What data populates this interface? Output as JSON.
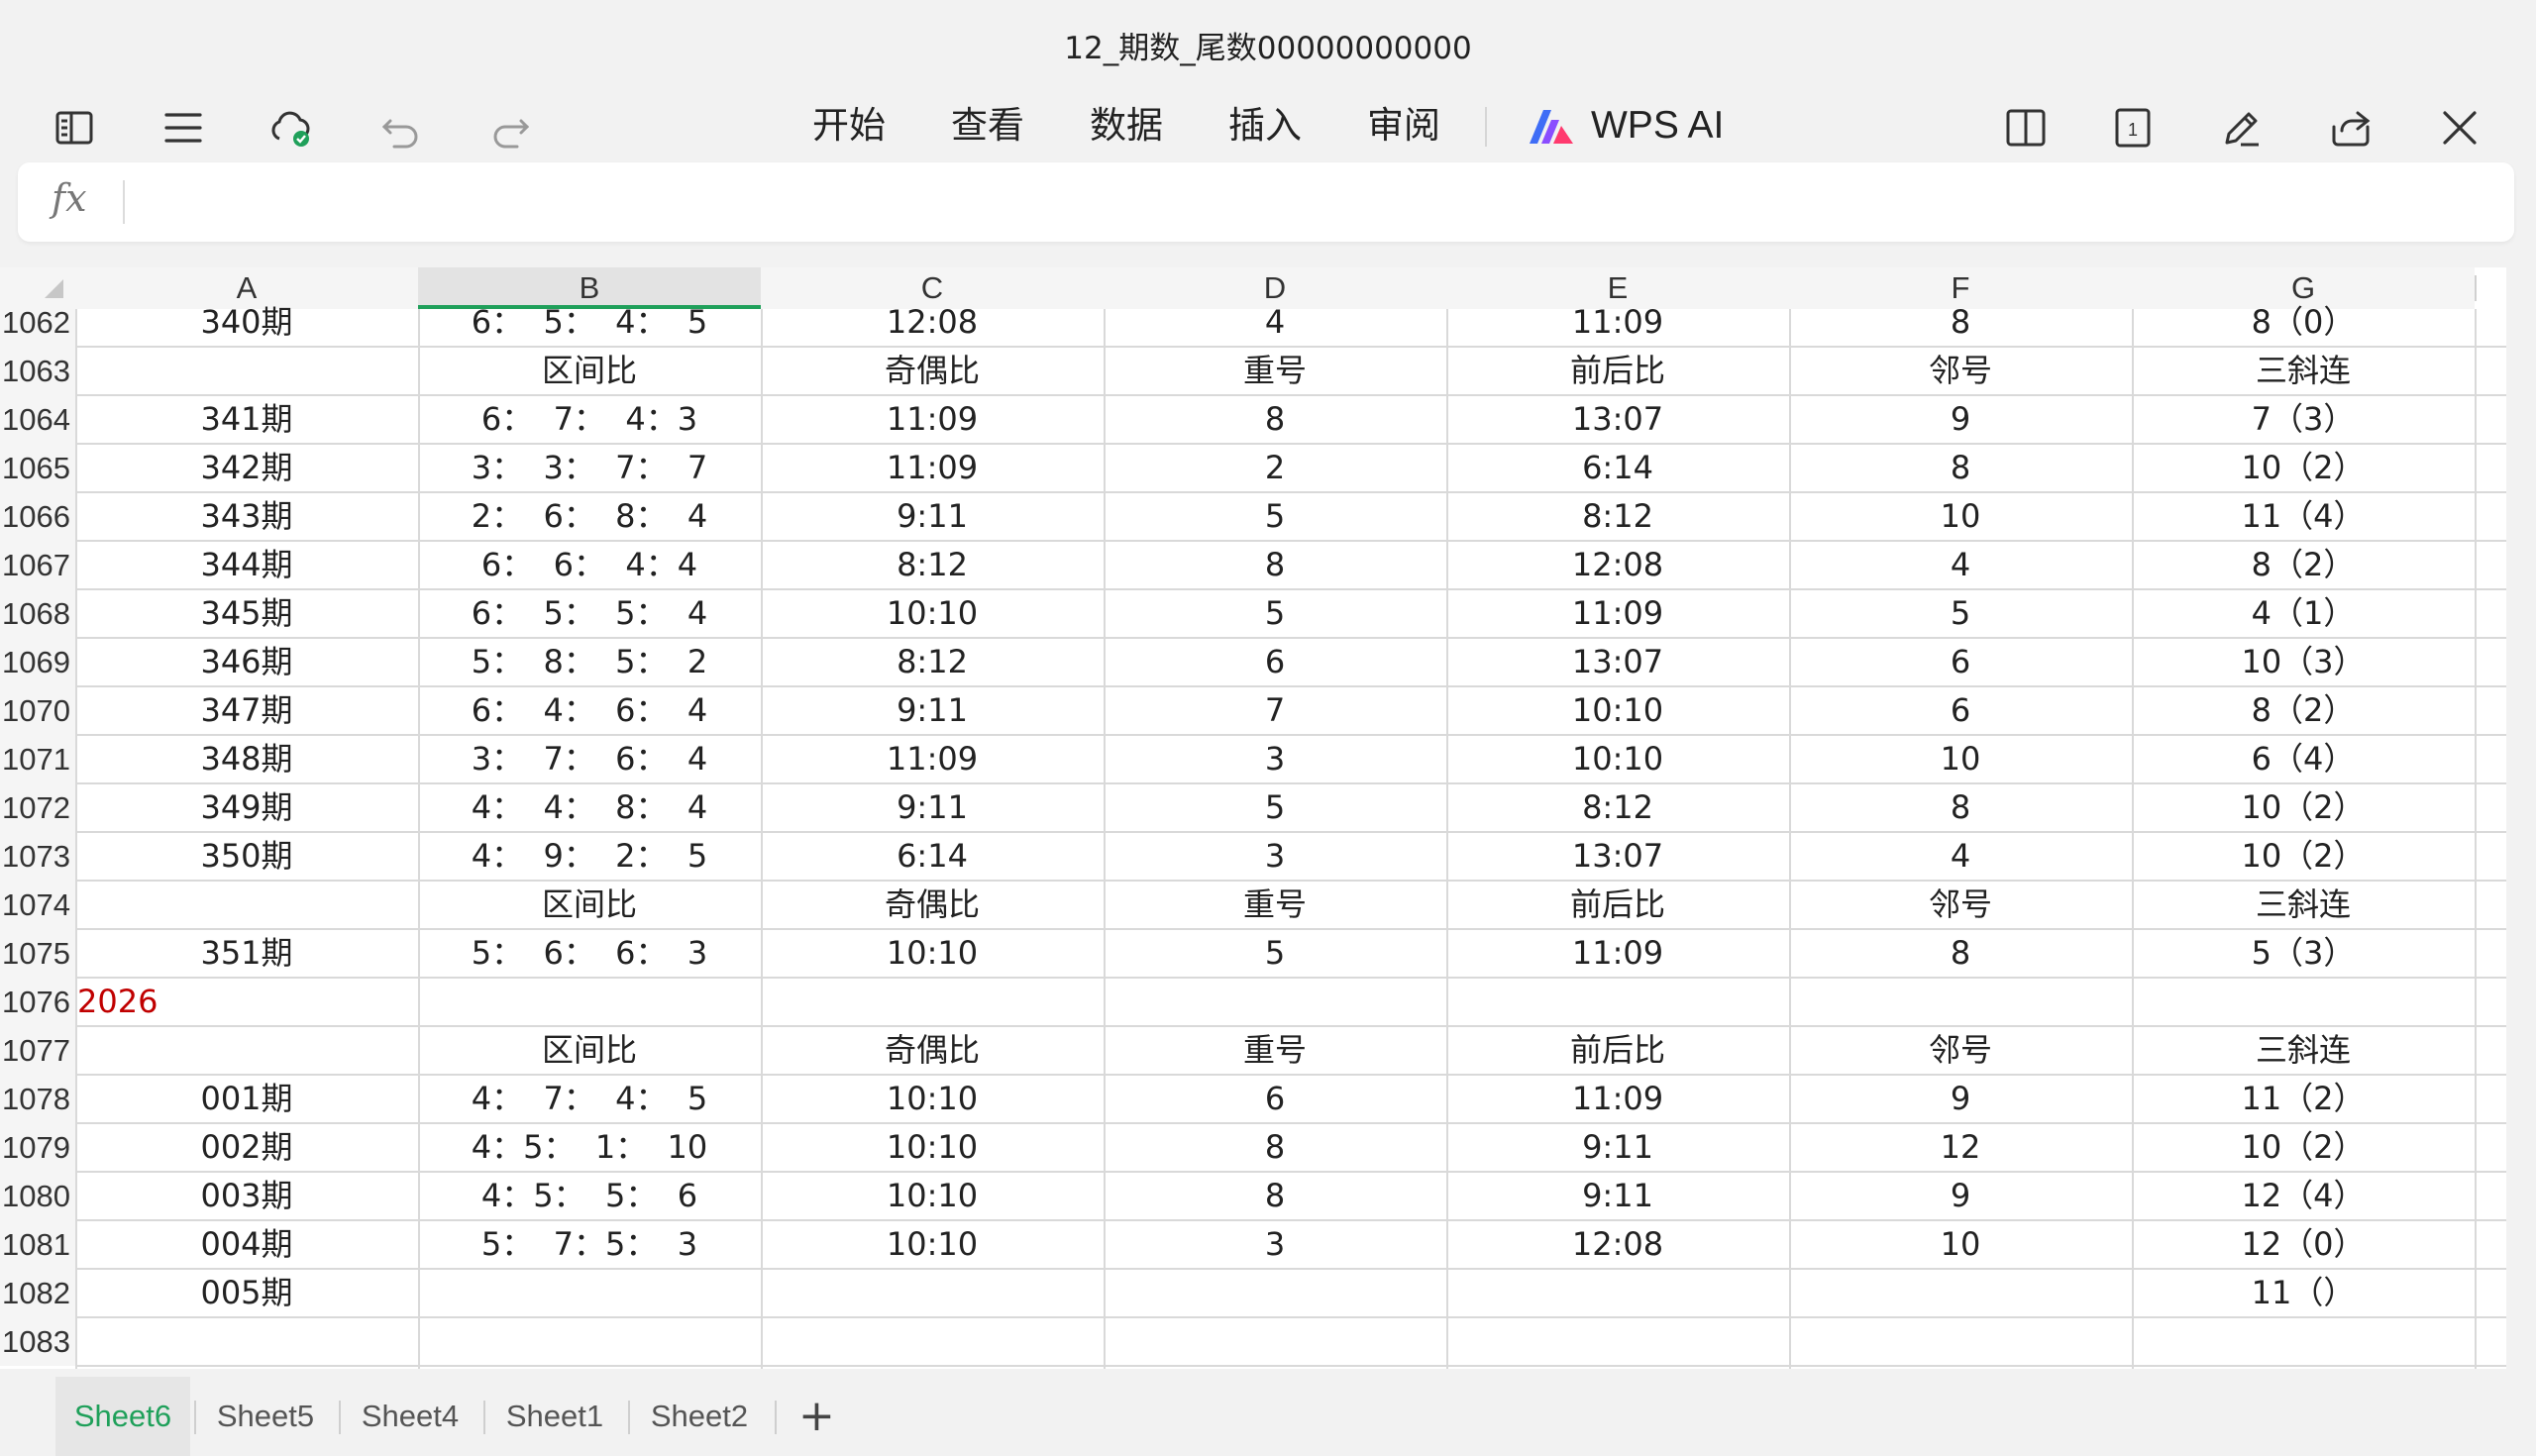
{
  "window": {
    "title": "12_期数_尾数00000000000"
  },
  "toolbar": {
    "left_icons": [
      "sidebar-toggle-icon",
      "menu-icon",
      "cloud-synced-icon",
      "undo-icon",
      "redo-icon"
    ],
    "menus": [
      "开始",
      "查看",
      "数据",
      "插入",
      "审阅"
    ],
    "ai_label": "WPS AI",
    "right_icons": [
      "split-view-icon",
      "page-count-icon",
      "pen-edit-icon",
      "share-icon",
      "close-icon"
    ],
    "page_count": "1"
  },
  "formula_bar": {
    "fx_label": "fx",
    "value": ""
  },
  "columns": [
    "A",
    "B",
    "C",
    "D",
    "E",
    "F",
    "G"
  ],
  "selected_column": "B",
  "rows": [
    {
      "num": "1062",
      "cells": [
        "340期",
        "6：  5：  4：  5",
        "12:08",
        "4",
        "11:09",
        "8",
        "8（0）"
      ]
    },
    {
      "num": "1063",
      "cells": [
        "",
        "区间比",
        "奇偶比",
        "重号",
        "前后比",
        "邻号",
        "三斜连"
      ]
    },
    {
      "num": "1064",
      "cells": [
        "341期",
        "6：  7：  4：3",
        "11:09",
        "8",
        "13:07",
        "9",
        "7（3）"
      ]
    },
    {
      "num": "1065",
      "cells": [
        "342期",
        "3：  3：  7：  7",
        "11:09",
        "2",
        "6:14",
        "8",
        "10（2）"
      ]
    },
    {
      "num": "1066",
      "cells": [
        "343期",
        "2：  6：  8：  4",
        "9:11",
        "5",
        "8:12",
        "10",
        "11（4）"
      ]
    },
    {
      "num": "1067",
      "cells": [
        "344期",
        "6：  6：  4：4",
        "8:12",
        "8",
        "12:08",
        "4",
        "8（2）"
      ]
    },
    {
      "num": "1068",
      "cells": [
        "345期",
        "6：  5：  5：  4",
        "10:10",
        "5",
        "11:09",
        "5",
        "4（1）"
      ]
    },
    {
      "num": "1069",
      "cells": [
        "346期",
        "5：  8：  5：  2",
        "8:12",
        "6",
        "13:07",
        "6",
        "10（3）"
      ]
    },
    {
      "num": "1070",
      "cells": [
        "347期",
        "6：  4：  6：  4",
        "9:11",
        "7",
        "10:10",
        "6",
        "8（2）"
      ]
    },
    {
      "num": "1071",
      "cells": [
        "348期",
        "3：  7：  6：  4",
        "11:09",
        "3",
        "10:10",
        "10",
        "6（4）"
      ]
    },
    {
      "num": "1072",
      "cells": [
        "349期",
        "4：  4：  8：  4",
        "9:11",
        "5",
        "8:12",
        "8",
        "10（2）"
      ]
    },
    {
      "num": "1073",
      "cells": [
        "350期",
        "4：  9：  2：  5",
        "6:14",
        "3",
        "13:07",
        "4",
        "10（2）"
      ]
    },
    {
      "num": "1074",
      "cells": [
        "",
        "区间比",
        "奇偶比",
        "重号",
        "前后比",
        "邻号",
        "三斜连"
      ]
    },
    {
      "num": "1075",
      "cells": [
        "351期",
        "5：  6：  6：  3",
        "10:10",
        "5",
        "11:09",
        "8",
        "5（3）"
      ]
    },
    {
      "num": "1076",
      "year": "2026",
      "cells": [
        "",
        "",
        "",
        "",
        "",
        "",
        ""
      ]
    },
    {
      "num": "1077",
      "cells": [
        "",
        "区间比",
        "奇偶比",
        "重号",
        "前后比",
        "邻号",
        "三斜连"
      ]
    },
    {
      "num": "1078",
      "cells": [
        "001期",
        "4：  7：  4：  5",
        "10:10",
        "6",
        "11:09",
        "9",
        "11（2）"
      ]
    },
    {
      "num": "1079",
      "cells": [
        "002期",
        "4：5：  1：  10",
        "10:10",
        "8",
        "9:11",
        "12",
        "10（2）"
      ]
    },
    {
      "num": "1080",
      "cells": [
        "003期",
        "4：5：  5：  6",
        "10:10",
        "8",
        "9:11",
        "9",
        "12（4）"
      ]
    },
    {
      "num": "1081",
      "cells": [
        "004期",
        "5：  7：5：  3",
        "10:10",
        "3",
        "12:08",
        "10",
        "12（0）"
      ]
    },
    {
      "num": "1082",
      "cells": [
        "005期",
        "",
        "",
        "",
        "",
        "",
        "11（）"
      ]
    },
    {
      "num": "1083",
      "cells": [
        "",
        "",
        "",
        "",
        "",
        "",
        ""
      ]
    }
  ],
  "sheet_tabs": [
    "Sheet6",
    "Sheet5",
    "Sheet4",
    "Sheet1",
    "Sheet2"
  ],
  "active_tab": "Sheet6",
  "add_tab_label": "+",
  "colors": {
    "accent": "#1fa05a",
    "year_text": "#c00000",
    "grid": "#d9d9d9"
  }
}
